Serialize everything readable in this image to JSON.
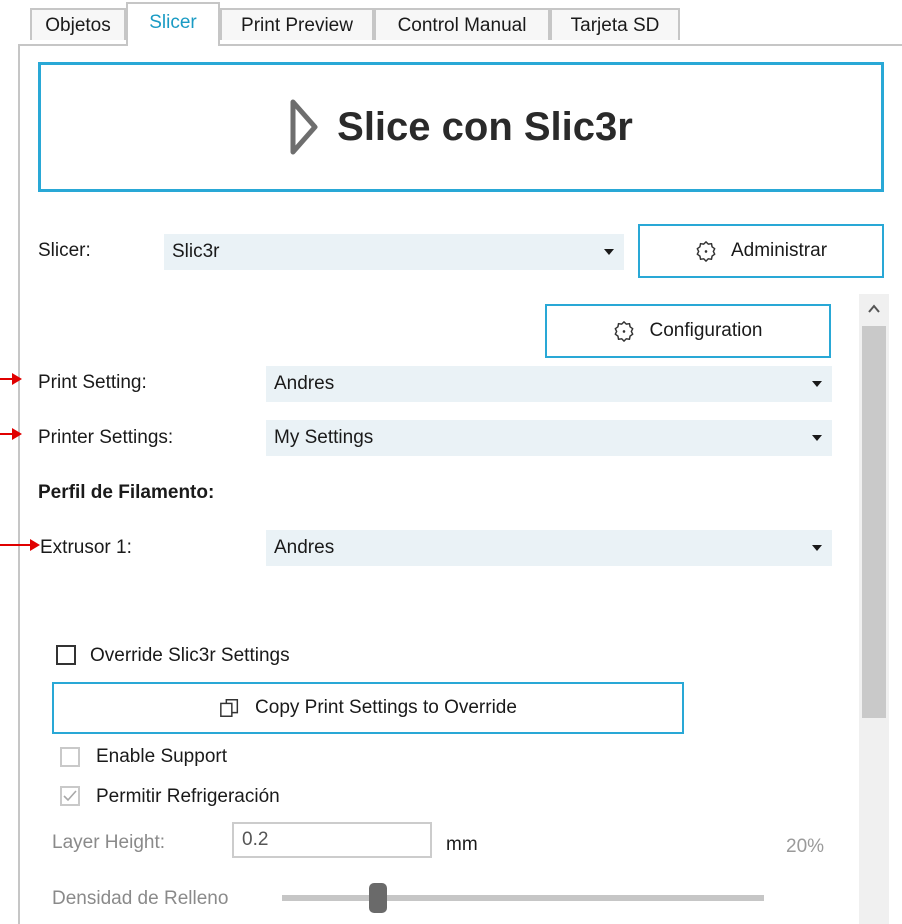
{
  "tabs": [
    {
      "label": "Objetos"
    },
    {
      "label": "Slicer"
    },
    {
      "label": "Print Preview"
    },
    {
      "label": "Control Manual"
    },
    {
      "label": "Tarjeta SD"
    }
  ],
  "active_tab": "Slicer",
  "slice_button": {
    "label": "Slice con Slic3r"
  },
  "slicer_row": {
    "label": "Slicer:",
    "value": "Slic3r",
    "manage_label": "Administrar"
  },
  "configuration_label": "Configuration",
  "print_setting": {
    "label": "Print Setting:",
    "value": "Andres"
  },
  "printer_settings": {
    "label": "Printer Settings:",
    "value": "My Settings"
  },
  "filament_profile": {
    "title": "Perfil de Filamento:"
  },
  "extruder1": {
    "label": "Extrusor 1:",
    "value": "Andres"
  },
  "override": {
    "label": "Override Slic3r Settings",
    "checked": false
  },
  "copy_button": {
    "label": "Copy Print Settings to Override"
  },
  "enable_support": {
    "label": "Enable Support",
    "checked": false
  },
  "cooling": {
    "label": "Permitir Refrigeración",
    "checked": true
  },
  "layer_height": {
    "label": "Layer Height:",
    "value": "0.2",
    "unit": "mm",
    "percent": "20%"
  },
  "infill": {
    "label": "Densidad de Relleno",
    "value_fraction": 0.2
  },
  "colors": {
    "accent": "#29a8d6",
    "active_tab_text": "#1a9bc4",
    "combo_bg": "#eaf2f6",
    "annotation_arrow": "#e00000"
  }
}
